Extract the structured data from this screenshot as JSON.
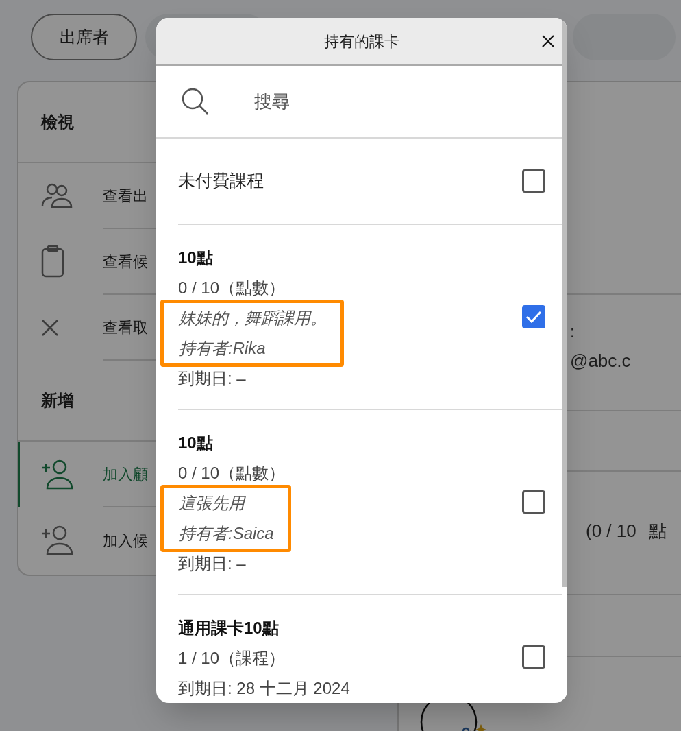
{
  "background": {
    "chips": [
      {
        "label": "出席者"
      }
    ],
    "sections": [
      {
        "title": "檢視",
        "items": [
          {
            "label": "查看出",
            "selected": false
          },
          {
            "label": "查看候",
            "selected": false
          },
          {
            "label": "查看取",
            "selected": false
          }
        ]
      },
      {
        "title": "新增",
        "items": [
          {
            "label": "加入顧",
            "selected": true
          },
          {
            "label": "加入候",
            "selected": false
          }
        ]
      }
    ],
    "detail": {
      "email_colon": ":",
      "email": "@abc.c",
      "balance": "(0 / 10",
      "unit": "點"
    }
  },
  "modal": {
    "title": "持有的課卡",
    "search": {
      "placeholder": "搜尋"
    },
    "options": [
      {
        "kind": "unpaid",
        "label": "未付費課程",
        "checked": false
      },
      {
        "kind": "card",
        "title": "10點",
        "balance": "0 / 10（點數）",
        "note": "妹妹的，舞蹈課用。",
        "holder": "持有者:Rika",
        "expiry": "到期日: –",
        "highlighted": true,
        "checked": true
      },
      {
        "kind": "card",
        "title": "10點",
        "balance": "0 / 10（點數）",
        "note": "這張先用",
        "holder": "持有者:Saica",
        "expiry": "到期日: –",
        "highlighted": true,
        "checked": false
      },
      {
        "kind": "card",
        "title": "通用課卡10點",
        "balance": "1 / 10（課程）",
        "expiry": "到期日: 28 十二月 2024",
        "highlighted": false,
        "checked": false
      }
    ]
  }
}
